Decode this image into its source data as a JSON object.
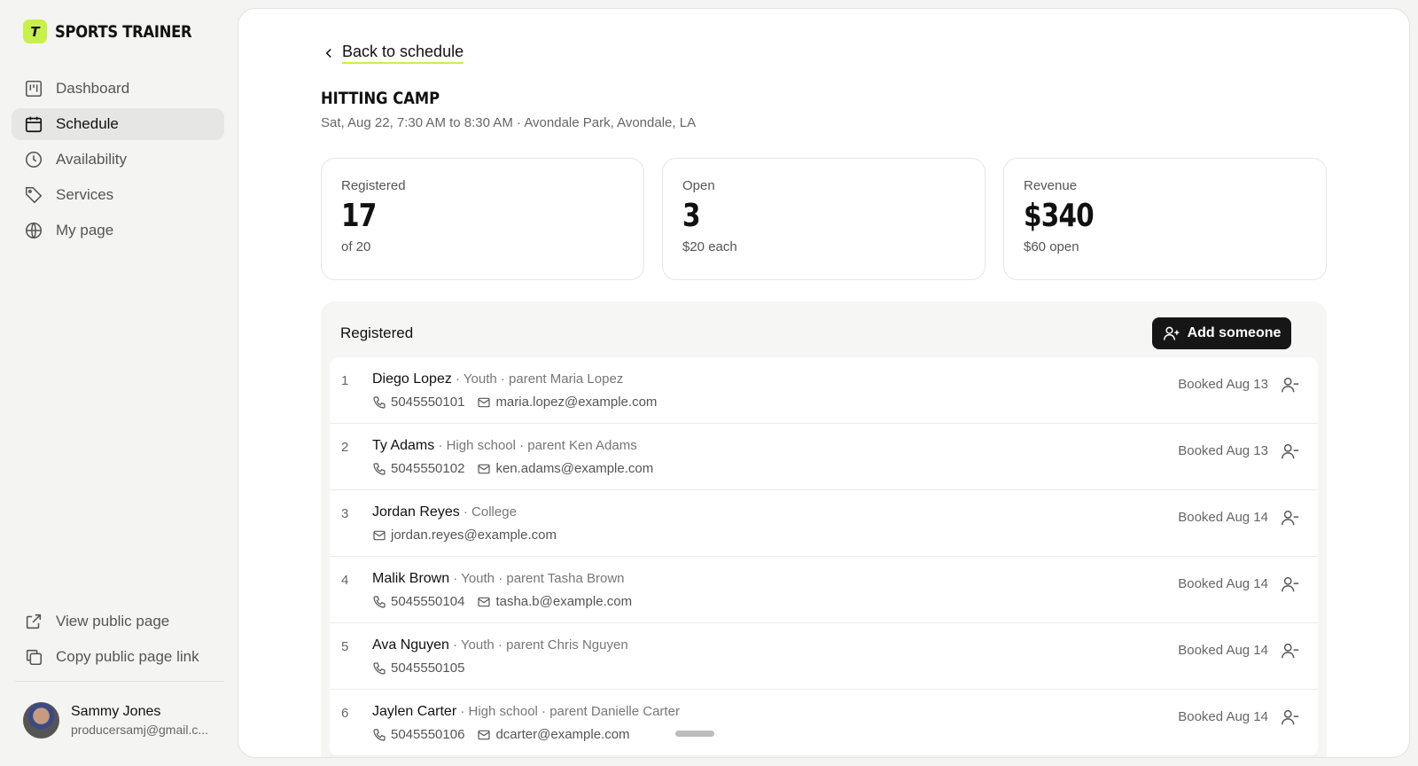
{
  "brand": {
    "logo_letter": "T",
    "name": "SPORTS TRAINER"
  },
  "nav": [
    {
      "label": "Dashboard",
      "icon": "dashboard-icon",
      "active": false
    },
    {
      "label": "Schedule",
      "icon": "calendar-icon",
      "active": true
    },
    {
      "label": "Availability",
      "icon": "clock-icon",
      "active": false
    },
    {
      "label": "Services",
      "icon": "tag-icon",
      "active": false
    },
    {
      "label": "My page",
      "icon": "globe-icon",
      "active": false
    }
  ],
  "sidebar_bottom": {
    "view_public": "View public page",
    "copy_link": "Copy public page link"
  },
  "user": {
    "name": "Sammy Jones",
    "email": "producersamj@gmail.c..."
  },
  "main": {
    "back_label": "Back to schedule",
    "title": "HITTING CAMP",
    "subtitle": "Sat, Aug 22, 7:30 AM to 8:30 AM · Avondale Park, Avondale, LA"
  },
  "stats": [
    {
      "label": "Registered",
      "value": "17",
      "sub": "of 20"
    },
    {
      "label": "Open",
      "value": "3",
      "sub": "$20 each"
    },
    {
      "label": "Revenue",
      "value": "$340",
      "sub": "$60 open"
    }
  ],
  "registered": {
    "heading": "Registered",
    "add_label": "Add someone",
    "rows": [
      {
        "num": "1",
        "name": "Diego Lopez",
        "meta": " · Youth · parent Maria Lopez",
        "phone": "5045550101",
        "email": "maria.lopez@example.com",
        "booked": "Booked Aug 13"
      },
      {
        "num": "2",
        "name": "Ty Adams",
        "meta": " · High school · parent Ken Adams",
        "phone": "5045550102",
        "email": "ken.adams@example.com",
        "booked": "Booked Aug 13"
      },
      {
        "num": "3",
        "name": "Jordan Reyes",
        "meta": " · College",
        "phone": "",
        "email": "jordan.reyes@example.com",
        "booked": "Booked Aug 14"
      },
      {
        "num": "4",
        "name": "Malik Brown",
        "meta": " · Youth · parent Tasha Brown",
        "phone": "5045550104",
        "email": "tasha.b@example.com",
        "booked": "Booked Aug 14"
      },
      {
        "num": "5",
        "name": "Ava Nguyen",
        "meta": " · Youth · parent Chris Nguyen",
        "phone": "5045550105",
        "email": "",
        "booked": "Booked Aug 14"
      },
      {
        "num": "6",
        "name": "Jaylen Carter",
        "meta": " · High school · parent Danielle Carter",
        "phone": "5045550106",
        "email": "dcarter@example.com",
        "booked": "Booked Aug 14"
      }
    ]
  },
  "colors": {
    "accent": "#c8f04a",
    "button_dark": "#161616",
    "active_nav": "#e6e6e5"
  }
}
